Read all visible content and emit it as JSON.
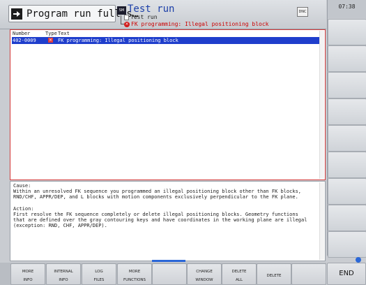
{
  "header": {
    "mode_title": "Program run full s…",
    "program_title": "Test run",
    "program_icon_label": "SM",
    "tree": [
      "Test run",
      "FK programming: Illegal positioning block"
    ],
    "dnc_label": "DNC",
    "clock": "07:38"
  },
  "list": {
    "columns": [
      "Number",
      "Type",
      "Text"
    ],
    "rows": [
      {
        "number": "402-0009",
        "type_icon": "×",
        "text": "FK programming: Illegal positioning block"
      }
    ]
  },
  "detail": {
    "lines": [
      "Cause:",
      "Within an unresolved FK sequence you programmed an illegal positioning block other than FK blocks,",
      "RND/CHF, APPR/DEP, and L blocks with motion components exclusively perpendicular to the FK plane.",
      "",
      "Action:",
      "First resolve the FK sequence completely or delete illegal positioning blocks. Geometry functions",
      "that are defined over the gray contouring keys and have coordinates in the working plane are illegal",
      "(exception: RND, CHF, APPR/DEP)."
    ]
  },
  "softkeys": {
    "more_info": [
      "MORE",
      "INFO"
    ],
    "internal_info": [
      "INTERNAL",
      "INFO"
    ],
    "log_files": [
      "LOG",
      "FILES"
    ],
    "more_functions": [
      "MORE",
      "FUNCTIONS"
    ],
    "change_window": [
      "CHANGE",
      "WINDOW"
    ],
    "delete_all": [
      "DELETE",
      "ALL"
    ],
    "delete": "DELETE",
    "end": "END"
  },
  "colors": {
    "selection": "#1f3ecc",
    "error": "#d21b1b",
    "accent": "#2a67d8"
  }
}
